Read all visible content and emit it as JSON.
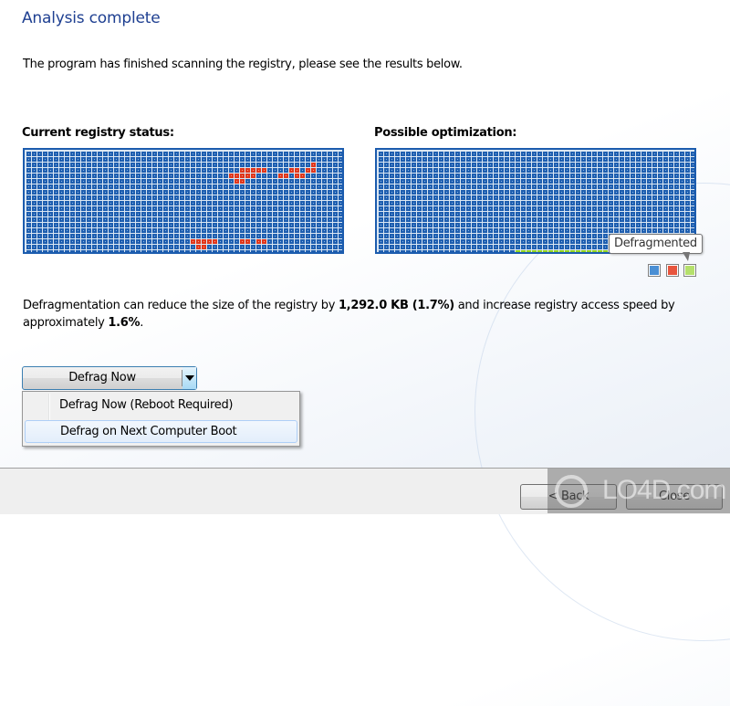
{
  "header": {
    "title": "Analysis complete",
    "intro": "The program has finished scanning the registry, please see the results below."
  },
  "current_status": {
    "label": "Current registry status:",
    "grid": {
      "columns": 58,
      "rows": 19,
      "fragmented_cells": [
        [
          2,
          52
        ],
        [
          3,
          39
        ],
        [
          3,
          40
        ],
        [
          3,
          41
        ],
        [
          3,
          42
        ],
        [
          3,
          43
        ],
        [
          3,
          48
        ],
        [
          3,
          49
        ],
        [
          3,
          51
        ],
        [
          3,
          52
        ],
        [
          4,
          37
        ],
        [
          4,
          38
        ],
        [
          4,
          39
        ],
        [
          4,
          40
        ],
        [
          4,
          41
        ],
        [
          4,
          46
        ],
        [
          4,
          47
        ],
        [
          4,
          49
        ],
        [
          4,
          50
        ],
        [
          5,
          38
        ],
        [
          5,
          39
        ],
        [
          16,
          30
        ],
        [
          16,
          31
        ],
        [
          16,
          32
        ],
        [
          16,
          33
        ],
        [
          16,
          34
        ],
        [
          16,
          39
        ],
        [
          16,
          40
        ],
        [
          16,
          42
        ],
        [
          16,
          43
        ],
        [
          17,
          31
        ],
        [
          17,
          32
        ]
      ]
    }
  },
  "optimization": {
    "label": "Possible optimization:",
    "grid": {
      "columns": 58,
      "rows": 19,
      "defragmented_last_row_from_col": 25
    },
    "tooltip": "Defragmented",
    "legend": [
      {
        "name": "used",
        "color": "#4a8fd4"
      },
      {
        "name": "fragmented",
        "color": "#e8553e"
      },
      {
        "name": "defragmented",
        "color": "#b5e06c"
      }
    ]
  },
  "colors": {
    "cell_used": "#1f5fb0",
    "cell_used_inner": "#8ab4e3",
    "cell_fragmented": "#e0371c",
    "cell_fragmented_inner": "#f79a85",
    "cell_defragmented": "#8fd21d",
    "grid_bg": "#dbe7f3",
    "title": "#1e3f91"
  },
  "description": {
    "prefix": "Defragmentation can reduce the size of the registry by ",
    "size": "1,292.0 KB (1.7%)",
    "middle": " and increase registry access speed by approximately ",
    "speed": "1.6%",
    "suffix": "."
  },
  "defrag_button": {
    "label": "Defrag Now",
    "menu": [
      {
        "label": "Defrag Now (Reboot Required)",
        "highlighted": false
      },
      {
        "label": "Defrag on Next Computer Boot",
        "highlighted": true
      }
    ]
  },
  "footer": {
    "back_label": "< Back",
    "close_label": "Close"
  },
  "watermark": {
    "text": "LO4D.com"
  }
}
